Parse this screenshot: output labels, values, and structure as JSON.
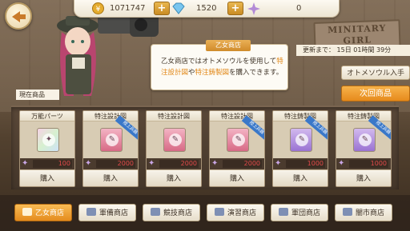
{
  "wall_sign": "MINITARY GIRL",
  "resources": {
    "coins": "1071747",
    "diamonds": "1520",
    "sparkle": "0"
  },
  "timer": "更新まで：  15日 01時間 39分",
  "dialog": {
    "title": "乙女商店",
    "text_before": "乙女商店ではオトメソウルを使用して",
    "hl1": "特注設計図",
    "mid": "や",
    "hl2": "特注鋳製図",
    "after": "を購入できます。"
  },
  "buttons": {
    "otome_soul": "オトメソウル入手",
    "next_item": "次回商品"
  },
  "shop_label": "現在商品",
  "cards": [
    {
      "name": "万能パーツ",
      "price": "100",
      "ribbon": "",
      "color": "rainbow"
    },
    {
      "name": "特注設計図",
      "price": "2000",
      "ribbon": "陸上兵器",
      "color": "pink"
    },
    {
      "name": "特注設計図",
      "price": "2000",
      "ribbon": "",
      "color": "pink"
    },
    {
      "name": "特注設計図",
      "price": "2000",
      "ribbon": "陸上兵器",
      "color": "pink"
    },
    {
      "name": "特注鋳製図",
      "price": "1000",
      "ribbon": "陸上兵器",
      "color": "purple"
    },
    {
      "name": "特注鋳製図",
      "price": "1000",
      "ribbon": "陸上兵器",
      "color": "purple"
    }
  ],
  "buy_label": "購入",
  "tabs": [
    "乙女商店",
    "軍備商店",
    "競技商店",
    "演習商店",
    "軍団商店",
    "闇市商店"
  ],
  "colors": {
    "accent": "#e68a1c",
    "price": "#e24a4a"
  }
}
